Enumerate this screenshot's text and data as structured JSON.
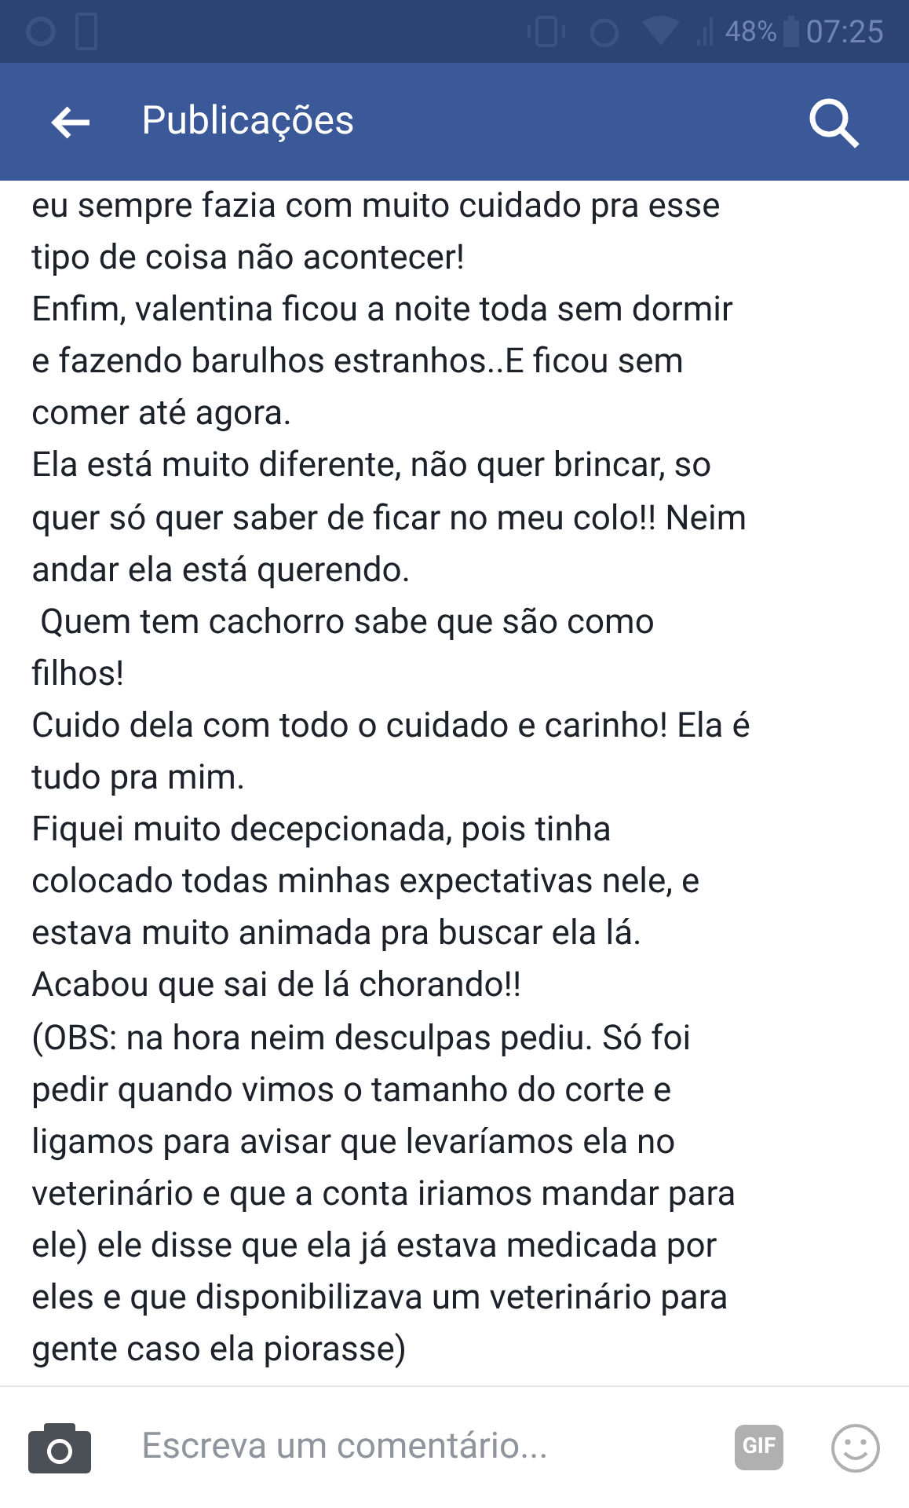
{
  "status_bar": {
    "battery": "48%",
    "time": "07:25"
  },
  "header": {
    "title": "Publicações"
  },
  "post_lines": [
    "eu sempre fazia com muito cuidado pra esse",
    "tipo de coisa não acontecer!",
    "Enfim, valentina ficou a noite toda sem dormir",
    "e fazendo barulhos estranhos..E ficou sem",
    "comer até agora.",
    "Ela está muito diferente, não quer brincar, so",
    "quer só quer saber de ficar no meu colo!! Neim",
    "andar ela está querendo.",
    " Quem tem cachorro sabe que são como",
    "filhos!",
    "Cuido dela com todo o cuidado e carinho! Ela é",
    "tudo pra mim.",
    "Fiquei muito decepcionada, pois tinha",
    "colocado todas minhas expectativas nele, e",
    "estava muito animada pra buscar ela lá.",
    "Acabou que sai de lá chorando!!",
    "(OBS: na hora neim desculpas pediu. Só foi",
    "pedir quando vimos o tamanho do corte e",
    "ligamos para avisar que levaríamos ela no",
    "veterinário e que a conta iriamos mandar para",
    "ele) ele disse que ela já estava medicada por",
    "eles e que disponibilizava um veterinário para",
    "gente caso ela piorasse)"
  ],
  "comment_bar": {
    "placeholder": "Escreva um comentário...",
    "gif_label": "GIF"
  }
}
